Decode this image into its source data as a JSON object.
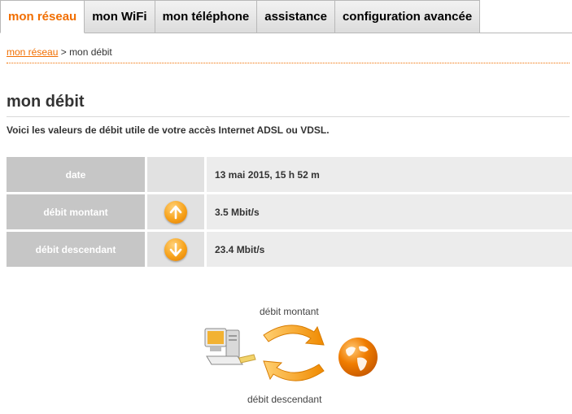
{
  "tabs": [
    {
      "label": "mon réseau",
      "active": true
    },
    {
      "label": "mon WiFi",
      "active": false
    },
    {
      "label": "mon téléphone",
      "active": false
    },
    {
      "label": "assistance",
      "active": false
    },
    {
      "label": "configuration avancée",
      "active": false
    }
  ],
  "breadcrumb": {
    "link": "mon réseau",
    "separator": " > ",
    "current": "mon débit"
  },
  "page": {
    "title": "mon débit",
    "intro": "Voici les valeurs de débit utile de votre accès Internet ADSL ou VDSL."
  },
  "table": {
    "rows": [
      {
        "label": "date",
        "icon": "",
        "value": "13 mai 2015, 15 h 52 m"
      },
      {
        "label": "débit montant",
        "icon": "arrow-up-icon",
        "value": "3.5 Mbit/s"
      },
      {
        "label": "débit descendant",
        "icon": "arrow-down-icon",
        "value": "23.4 Mbit/s"
      }
    ]
  },
  "diagram": {
    "upload_label": "débit montant",
    "download_label": "débit descendant"
  },
  "colors": {
    "accent": "#f16e00",
    "label_bg": "#c6c6c6",
    "value_bg": "#ececec"
  }
}
